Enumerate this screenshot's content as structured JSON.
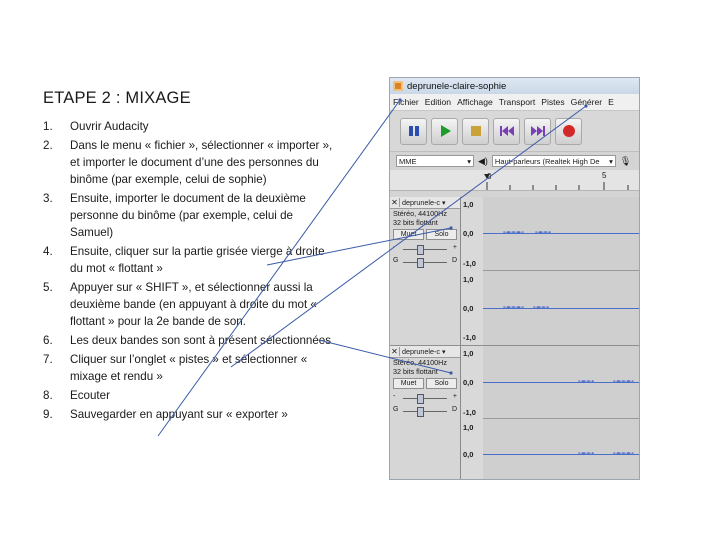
{
  "title": "ETAPE 2 : MIXAGE",
  "steps": [
    {
      "num": "1.",
      "text": "Ouvrir Audacity"
    },
    {
      "num": "2.",
      "text": "Dans le menu « fichier », sélectionner « importer », et importer le document d’une des personnes du binôme (par exemple, celui de sophie)"
    },
    {
      "num": "3.",
      "text": "Ensuite, importer le document de la deuxième personne du binôme (par exemple, celui de Samuel)"
    },
    {
      "num": "4.",
      "text": "Ensuite, cliquer sur la partie grisée vierge à droite du mot « flottant »"
    },
    {
      "num": "5.",
      "text": "Appuyer sur « SHIFT », et sélectionner aussi la deuxième bande (en appuyant à droite du mot « flottant » pour la 2e bande de son."
    },
    {
      "num": "6.",
      "text": "Les deux bandes son sont à présent sélectionnées"
    },
    {
      "num": "7.",
      "text": "Cliquer sur l’onglet « pistes » et sélectionner « mixage et rendu »"
    },
    {
      "num": "8.",
      "text": "Ecouter"
    },
    {
      "num": "9.",
      "text": "Sauvegarder en appuyant sur « exporter »"
    }
  ],
  "audacity": {
    "window_title": "deprunele-claire-sophie",
    "menu": [
      "Fichier",
      "Edition",
      "Affichage",
      "Transport",
      "Pistes",
      "Générer",
      "E"
    ],
    "host_combo": "MME",
    "output_combo": "Haut-parleurs (Realtek High De",
    "ruler_labels": [
      "0",
      "5"
    ],
    "track_name": "deprunele-c",
    "track_format": "Stéréo, 44100Hz",
    "track_bits": "32 bits flottant",
    "mute_label": "Muet",
    "solo_label": "Solo",
    "minus_label": "-",
    "plus_label": "+",
    "gain_l": "G",
    "gain_r": "D",
    "scale": [
      "1,0",
      "0,0",
      "-1,0"
    ],
    "icons": [
      "pause-icon",
      "play-icon",
      "stop-icon",
      "skip-start-icon",
      "skip-end-icon",
      "record-icon"
    ]
  }
}
